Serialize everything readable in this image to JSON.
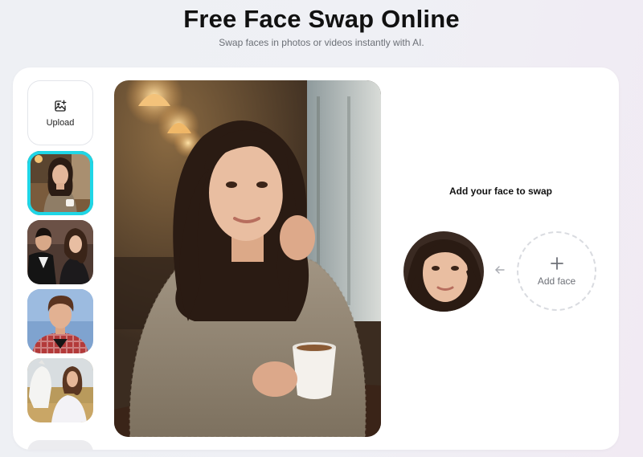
{
  "header": {
    "title": "Free Face Swap Online",
    "subtitle": "Swap faces in photos or videos instantly with AI."
  },
  "sidebar": {
    "upload_label": "Upload",
    "upload_icon": "image-upload-icon",
    "thumbnails": [
      {
        "name": "thumb-woman-cafe",
        "selected": true
      },
      {
        "name": "thumb-couple-formal",
        "selected": false
      },
      {
        "name": "thumb-boy-plaid",
        "selected": false
      },
      {
        "name": "thumb-woman-horse",
        "selected": false
      }
    ]
  },
  "swap_panel": {
    "instruction": "Add your face to swap",
    "add_face_label": "Add face",
    "arrow_icon": "arrow-left-icon",
    "plus_icon": "plus-icon"
  },
  "colors": {
    "accent_selected": "#1fd6e6",
    "title": "#111111",
    "muted": "#6b6f76"
  }
}
